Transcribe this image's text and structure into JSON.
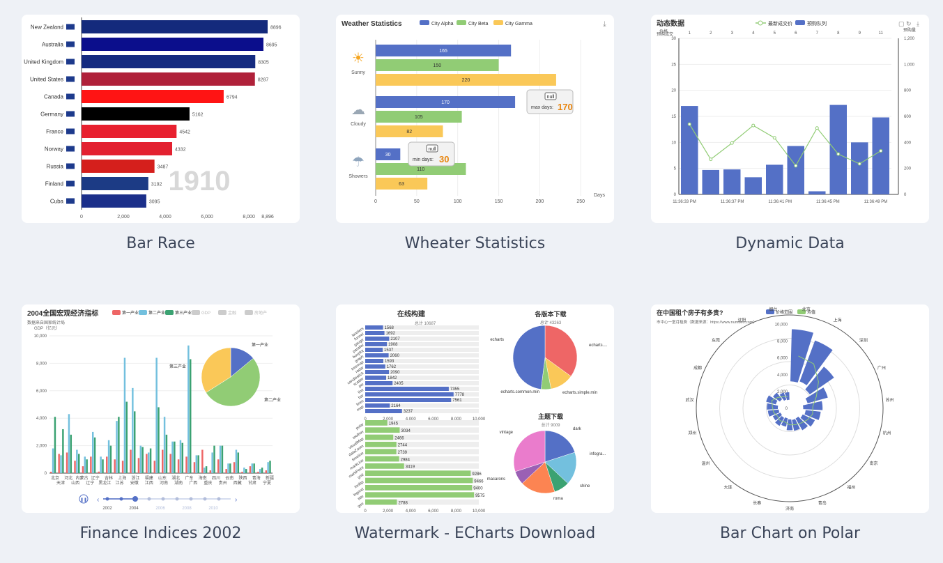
{
  "gallery": {
    "items": [
      {
        "caption": "Bar Race"
      },
      {
        "caption": "Wheater Statistics"
      },
      {
        "caption": "Dynamic Data"
      },
      {
        "caption": "Finance Indices 2002"
      },
      {
        "caption": "Watermark - ECharts Download"
      },
      {
        "caption": "Bar Chart on Polar"
      }
    ]
  },
  "chart_data": [
    {
      "type": "bar",
      "orientation": "horizontal",
      "overlay_label": "1910",
      "categories": [
        "New Zealand",
        "Australia",
        "United Kingdom",
        "United States",
        "Canada",
        "Germany",
        "France",
        "Norway",
        "Russia",
        "Finland",
        "Cuba"
      ],
      "values": [
        8896,
        8695,
        8305,
        8287,
        6794,
        5162,
        4542,
        4332,
        3487,
        3192,
        3095
      ],
      "colors": [
        "#142a7c",
        "#0b0e8c",
        "#152b80",
        "#b0213a",
        "#ff1414",
        "#000000",
        "#e8202f",
        "#e32130",
        "#d51f1c",
        "#1c3b85",
        "#1b2f8a"
      ],
      "xticks": [
        "0",
        "2,000",
        "4,000",
        "6,000",
        "8,000",
        "8,896"
      ],
      "xlim": [
        0,
        8896
      ]
    },
    {
      "type": "bar",
      "orientation": "horizontal",
      "title": "Weather Statistics",
      "legend": [
        "City Alpha",
        "City Beta",
        "City Gamma"
      ],
      "colors": [
        "#5470c6",
        "#91cc75",
        "#fac858"
      ],
      "categories": [
        "Sunny",
        "Cloudy",
        "Showers"
      ],
      "series": [
        {
          "name": "City Alpha",
          "values": [
            165,
            170,
            30
          ]
        },
        {
          "name": "City Beta",
          "values": [
            150,
            105,
            110
          ]
        },
        {
          "name": "City Gamma",
          "values": [
            220,
            82,
            63
          ]
        }
      ],
      "xticks": [
        "0",
        "50",
        "100",
        "150",
        "200",
        "250"
      ],
      "xlim": [
        0,
        260
      ],
      "xlabel": "Days",
      "max_tip": {
        "null": "null",
        "label": "max days:",
        "value": "170"
      },
      "min_tip": {
        "null": "null",
        "label": "min days:",
        "value": "30"
      }
    },
    {
      "type": "bar",
      "title": "动态数据",
      "legend": [
        "最新成交价",
        "预购队列"
      ],
      "left_axis_name": "价格",
      "left_axis_sub": "预购成交",
      "right_axis_name": "预购量",
      "top_ticks": [
        "1",
        "2",
        "3",
        "4",
        "5",
        "6",
        "7",
        "8",
        "9",
        "11"
      ],
      "left_ticks": [
        "0",
        "5",
        "10",
        "15",
        "20",
        "25",
        "30"
      ],
      "right_ticks": [
        "0",
        "200",
        "400",
        "600",
        "800",
        "1,000",
        "1,200"
      ],
      "bottom_ticks": [
        "11:36:33 PM",
        "11:36:37 PM",
        "11:36:41 PM",
        "11:36:45 PM",
        "11:36:49 PM"
      ],
      "bar_values": [
        17,
        4.7,
        4.8,
        3.3,
        5.7,
        9.3,
        0.6,
        17.2,
        10,
        14.8
      ],
      "line_values": [
        540,
        270,
        395,
        530,
        435,
        220,
        510,
        310,
        235,
        335
      ],
      "ylim_left": [
        0,
        30
      ],
      "ylim_right": [
        0,
        1200
      ]
    },
    {
      "type": "bar",
      "title": "2004全国宏观经济指标",
      "subtitle": "数据来自国家统计局",
      "ylabel": "GDP（亿元）",
      "legend": [
        "第一产业",
        "第二产业",
        "第三产业",
        "GDP",
        "金融",
        "房地产"
      ],
      "yticks": [
        "0",
        "2,000",
        "4,000",
        "6,000",
        "8,000",
        "10,000"
      ],
      "ylim": [
        0,
        10000
      ],
      "provinces_top": [
        "北京",
        "河北",
        "内蒙古",
        "辽宁",
        "吉林",
        "上海",
        "浙江",
        "福建",
        "山东",
        "湖北",
        "广东",
        "海南",
        "四川",
        "云南",
        "陕西",
        "青海",
        "新疆"
      ],
      "provinces_bottom": [
        "天津",
        "山西",
        "辽宁",
        "黑龙江",
        "江苏",
        "安徽",
        "江西",
        "河南",
        "湖南",
        "广西",
        "重庆",
        "贵州",
        "西藏",
        "甘肃",
        "宁夏"
      ],
      "series": [
        {
          "name": "第一产业",
          "values": [
            100,
            1400,
            1500,
            900,
            500,
            1200,
            110,
            1200,
            1000,
            900,
            1700,
            1100,
            1400,
            900,
            1700,
            1400,
            1000,
            1200,
            800,
            1700,
            200,
            1000,
            300,
            800,
            100,
            500,
            100,
            200
          ]
        },
        {
          "name": "第二产业",
          "values": [
            1800,
            1300,
            4300,
            1700,
            1200,
            3000,
            1200,
            2400,
            3800,
            8400,
            6200,
            2000,
            1500,
            8400,
            4100,
            2300,
            2400,
            9300,
            1300,
            400,
            1500,
            2000,
            700,
            1700,
            400,
            700,
            300,
            800
          ]
        },
        {
          "name": "第三产业",
          "values": [
            4100,
            3200,
            2800,
            1400,
            1000,
            2600,
            1000,
            2000,
            4100,
            5200,
            4500,
            1900,
            1800,
            4800,
            2800,
            2300,
            2200,
            8300,
            1300,
            500,
            2000,
            2000,
            700,
            1500,
            300,
            700,
            400,
            900
          ]
        }
      ],
      "timeline": [
        "2002",
        "2004",
        "2006",
        "2008",
        "2010"
      ],
      "pie": {
        "slices": [
          {
            "name": "第一产业",
            "value": 14
          },
          {
            "name": "第二产业",
            "value": 52
          },
          {
            "name": "第三产业",
            "value": 34
          }
        ]
      }
    },
    {
      "type": "bar",
      "charts": [
        {
          "title": "在线构建",
          "subtitle": "总计 10687",
          "categories": [
            "tanslers",
            "funnel",
            "gauge",
            "parallel",
            "boxplot",
            "graph",
            "treemap",
            "radar",
            "candlestick",
            "scatter",
            "pie",
            "line",
            "bar",
            "lines",
            "map"
          ],
          "values": [
            1568,
            1692,
            2107,
            1908,
            1537,
            2060,
            1593,
            1762,
            2090,
            1842,
            2405,
            7355,
            7778,
            7561,
            2164,
            3237
          ],
          "xticks": [
            "0",
            "2,000",
            "4,000",
            "6,000",
            "8,000",
            "10,000"
          ]
        },
        {
          "categories": [
            "polar",
            "toolbox",
            "visualMap",
            "dataZoom",
            "timeline",
            "markLine",
            "markPoint",
            "grid",
            "tooltip",
            "legend",
            "title",
            "geo"
          ],
          "values": [
            1945,
            3034,
            2466,
            2744,
            2739,
            2984,
            3419,
            9286,
            9466,
            9400,
            9575,
            2788
          ],
          "xticks": [
            "0",
            "2,000",
            "4,000",
            "6,000",
            "8,000",
            "10,000"
          ]
        },
        {
          "title": "各版本下载",
          "subtitle": "总计 43263",
          "type": "pie",
          "slices": [
            {
              "name": "echarts",
              "value": 35
            },
            {
              "name": "echarts.common.min",
              "value": 12
            },
            {
              "name": "echarts.simple.min",
              "value": 5
            },
            {
              "name": "echarts.min",
              "value": 48
            }
          ],
          "labels": [
            "echarts",
            "echarts....",
            "echarts.common.min",
            "echarts.simple.min"
          ]
        },
        {
          "title": "主题下载",
          "subtitle": "总计 9009",
          "type": "pie",
          "slices": [
            {
              "name": "vintage",
              "value": 20
            },
            {
              "name": "dark",
              "value": 17
            },
            {
              "name": "infographic",
              "value": 8
            },
            {
              "name": "shine",
              "value": 18
            },
            {
              "name": "roma",
              "value": 7
            },
            {
              "name": "macarons",
              "value": 30
            }
          ],
          "labels": [
            "vintage",
            "dark",
            "infogra...",
            "shine",
            "roma",
            "macarons"
          ]
        }
      ]
    },
    {
      "type": "bar",
      "polar": true,
      "title": "在中国租个房子有多贵?",
      "subtitle": "市中心一室月租费（数据来源：https://www.numbeo.com）",
      "legend": [
        "价格范围",
        "均值"
      ],
      "radial_ticks": [
        "0",
        "2,000",
        "4,000",
        "6,000",
        "8,000",
        "10,000"
      ],
      "cities": [
        "北京",
        "上海",
        "深圳",
        "广州",
        "苏州",
        "杭州",
        "南京",
        "福州",
        "青岛",
        "济南",
        "长春",
        "大连",
        "温州",
        "郑州",
        "武汉",
        "成都",
        "东莞",
        "沈阳",
        "烟台"
      ],
      "ranges": [
        [
          2800,
          9000
        ],
        [
          3000,
          8200
        ],
        [
          2500,
          6000
        ],
        [
          1800,
          4300
        ],
        [
          1200,
          3500
        ],
        [
          1500,
          3300
        ],
        [
          1300,
          2900
        ],
        [
          1000,
          2600
        ],
        [
          1000,
          2300
        ],
        [
          900,
          2200
        ],
        [
          800,
          1800
        ],
        [
          900,
          2000
        ],
        [
          800,
          1800
        ],
        [
          900,
          2200
        ],
        [
          1000,
          2300
        ],
        [
          1300,
          2500
        ],
        [
          1000,
          2000
        ],
        [
          700,
          1600
        ],
        [
          600,
          1500
        ]
      ]
    }
  ]
}
